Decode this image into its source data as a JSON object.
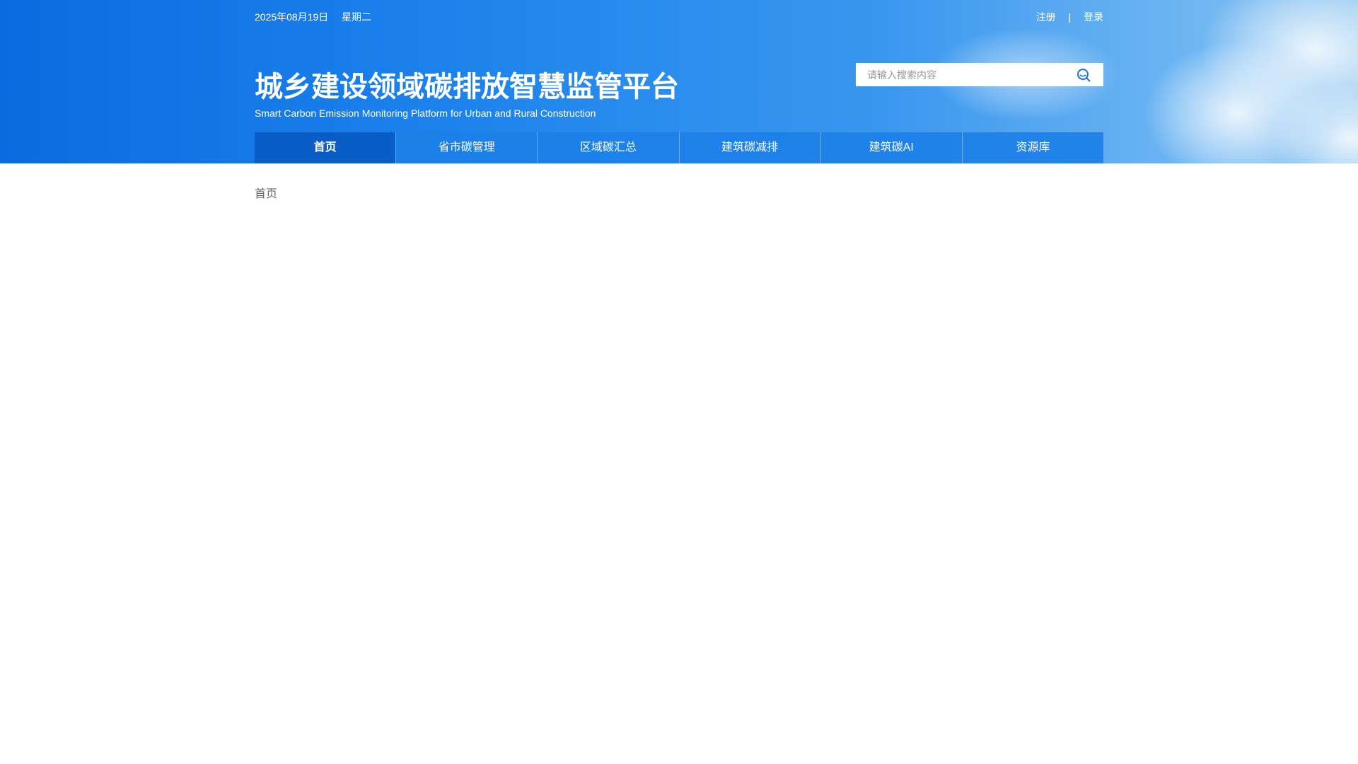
{
  "topbar": {
    "date": "2025年08月19日",
    "weekday": "星期二",
    "register_label": "注册",
    "separator": "|",
    "login_label": "登录"
  },
  "header": {
    "title": "城乡建设领域碳排放智慧监管平台",
    "subtitle": "Smart Carbon Emission Monitoring Platform for Urban and Rural Construction"
  },
  "search": {
    "placeholder": "请输入搜索内容",
    "icon": "search-icon"
  },
  "nav": {
    "items": [
      {
        "label": "首页",
        "active": true
      },
      {
        "label": "省市碳管理",
        "active": false
      },
      {
        "label": "区域碳汇总",
        "active": false
      },
      {
        "label": "建筑碳减排",
        "active": false
      },
      {
        "label": "建筑碳AI",
        "active": false
      },
      {
        "label": "资源库",
        "active": false
      }
    ]
  },
  "breadcrumb": {
    "current": "首页"
  },
  "colors": {
    "header_blue": "#1e84ec",
    "nav_active": "#0a5cc7",
    "search_icon": "#1a6fd8"
  }
}
